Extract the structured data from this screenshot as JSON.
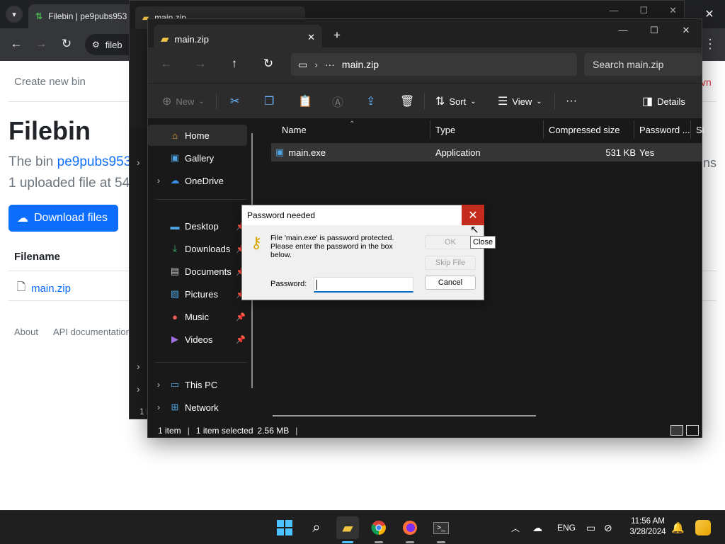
{
  "browser": {
    "tab_title": "Filebin | pe9pubs953",
    "address_text": "fileb",
    "close_glyph": "✕"
  },
  "page": {
    "create_new_bin": "Create new bin",
    "title": "Filebin",
    "bin_prefix": "The bin ",
    "bin_id": "pe9pubs953",
    "uploaded": "1 uploaded file at 54",
    "download_button": "Download files",
    "filename_header": "Filename",
    "file_name": "main.zip",
    "footer_about": "About",
    "footer_api": "API documentation",
    "edge_red_text": "vn",
    "edge_text": "ns"
  },
  "back_window": {
    "tab_title": "main.zip",
    "status": "1 i"
  },
  "explorer": {
    "tab_title": "main.zip",
    "address_path": "main.zip",
    "search_placeholder": "Search main.zip",
    "commands": {
      "new": "New",
      "sort": "Sort",
      "view": "View",
      "details": "Details"
    },
    "sidebar": {
      "home": "Home",
      "gallery": "Gallery",
      "onedrive": "OneDrive",
      "desktop": "Desktop",
      "downloads": "Downloads",
      "documents": "Documents",
      "pictures": "Pictures",
      "music": "Music",
      "videos": "Videos",
      "this_pc": "This PC",
      "network": "Network"
    },
    "columns": {
      "name": "Name",
      "type": "Type",
      "compressed_size": "Compressed size",
      "password": "Password ...",
      "size": "Si"
    },
    "file_row": {
      "name": "main.exe",
      "type": "Application",
      "compressed_size": "531 KB",
      "password": "Yes"
    },
    "status": {
      "items": "1 item",
      "selected": "1 item selected",
      "size": "2.56 MB"
    }
  },
  "dialog": {
    "title": "Password needed",
    "message": "File 'main.exe' is password protected. Please enter the password in the box below.",
    "password_label": "Password:",
    "password_value": "",
    "ok": "OK",
    "skip": "Skip File",
    "cancel": "Cancel",
    "close_tooltip": "Close"
  },
  "taskbar": {
    "language": "ENG",
    "time": "11:56 AM",
    "date": "3/28/2024"
  },
  "colors": {
    "dialog_close_red": "#c42b1c",
    "link_blue": "#0d6efd",
    "taskbar_accent": "#4cc2ff"
  }
}
